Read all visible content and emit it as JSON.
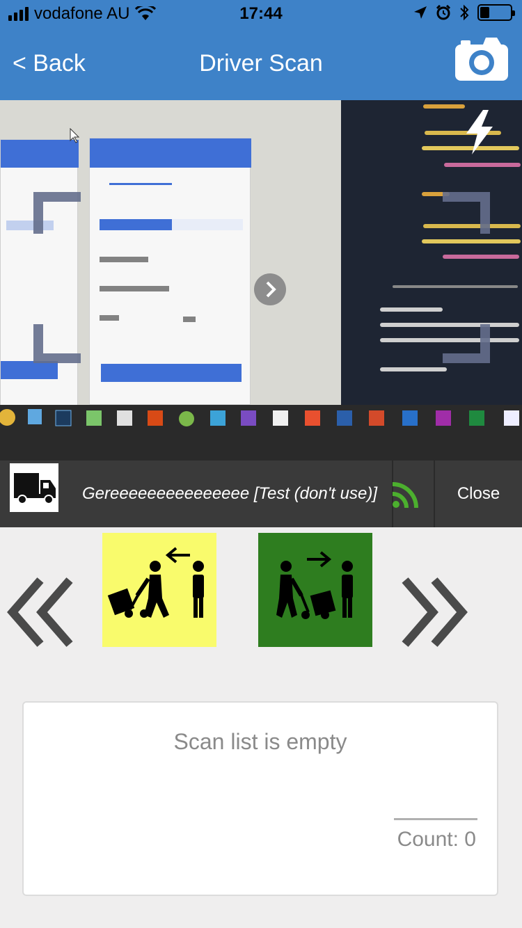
{
  "status_bar": {
    "carrier": "vodafone AU",
    "time": "17:44",
    "battery_level_percent": 30,
    "icons": [
      "signal-icon",
      "wifi-icon",
      "location-arrow-icon",
      "alarm-icon",
      "bluetooth-icon",
      "battery-icon"
    ]
  },
  "nav": {
    "back_label": "< Back",
    "title": "Driver Scan",
    "camera_icon": "camera-icon"
  },
  "camera": {
    "flash_icon": "flash-icon",
    "next_arrow_icon": "arrow-right-circle-icon"
  },
  "driver_bar": {
    "truck_icon": "truck-icon",
    "driver_name": "Gereeeeeeeeeeeeeee [Test (don't use)]",
    "connection_icon": "rss-feed-icon",
    "close_label": "Close"
  },
  "direction": {
    "prev_icon": "double-chevron-left-icon",
    "next_icon": "double-chevron-right-icon",
    "inbound_icon": "receive-parcel-icon",
    "outbound_icon": "deliver-parcel-icon"
  },
  "scan_list": {
    "empty_message": "Scan list is empty",
    "count_label": "Count: 0"
  },
  "colors": {
    "header_blue": "#3e82c8",
    "info_bar": "#3a3a3a",
    "inbound_tile": "#f9fb6c",
    "outbound_tile": "#2e7d1f",
    "rss_green": "#4caf2e",
    "chevron": "#4a4a4a"
  }
}
